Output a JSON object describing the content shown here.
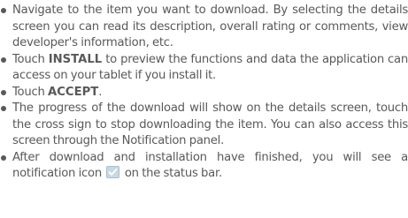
{
  "steps": [
    {
      "text": "Navigate to the item you want to download. By selecting the details screen you can read its description, overall rating or comments, view developer's information, etc."
    },
    {
      "pre": "Touch ",
      "bold": "INSTALL",
      "post": " to preview the functions and data the application can access on your tablet if you install it."
    },
    {
      "pre": "Touch ",
      "bold": "ACCEPT",
      "post": "."
    },
    {
      "text": "The progress of the download will show on the details screen, touch the cross sign to stop downloading the item. You can also access this screen through the Notification panel."
    },
    {
      "pre": "After download and installation have finished, you will see a notification icon",
      "icon": "download-complete-icon",
      "post": "on the status bar."
    }
  ],
  "colors": {
    "text": "#58595b",
    "icon_bg": "#c9d9e3",
    "icon_check": "#ffffff"
  }
}
